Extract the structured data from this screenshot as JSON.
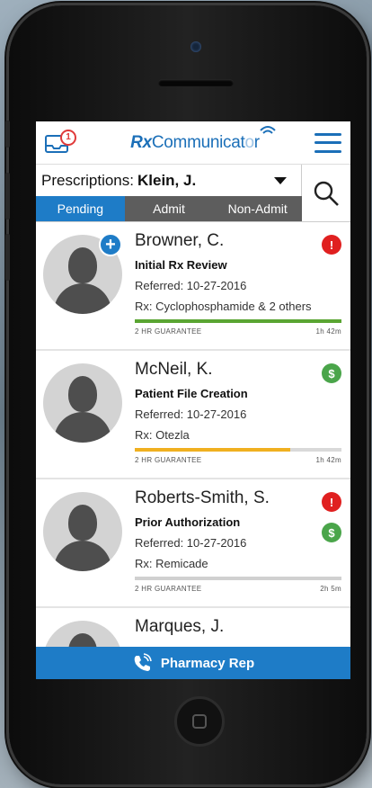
{
  "app": {
    "brand_prefix": "Rx",
    "brand_name": "Communicat",
    "brand_suffix": "r",
    "notifications": "1"
  },
  "filter": {
    "label": "Prescriptions:",
    "patient": "Klein, J.",
    "tabs": [
      {
        "label": "Pending",
        "active": true
      },
      {
        "label": "Admit",
        "active": false
      },
      {
        "label": "Non-Admit",
        "active": false
      }
    ]
  },
  "guarantee_label": "2 HR GUARANTEE",
  "items": [
    {
      "name": "Browner, C.",
      "task": "Initial Rx Review",
      "referred": "Referred: 10-27-2016",
      "rx": "Rx: Cyclophosphamide & 2 others",
      "timer": "1h 42m",
      "progress": 1.0,
      "bar_color": "#5aa532",
      "alert": true,
      "dollar": false,
      "add": true
    },
    {
      "name": "McNeil, K.",
      "task": "Patient File Creation",
      "referred": "Referred: 10-27-2016",
      "rx": "Rx: Otezla",
      "timer": "1h 42m",
      "progress": 0.75,
      "bar_color": "#f0b020",
      "alert": false,
      "dollar": true,
      "add": false
    },
    {
      "name": "Roberts-Smith, S.",
      "task": "Prior Authorization",
      "referred": "Referred: 10-27-2016",
      "rx": "Rx: Remicade",
      "timer": "2h 5m",
      "progress": 1.0,
      "bar_color": "#d0d0d0",
      "alert": true,
      "dollar": true,
      "add": false
    },
    {
      "name": "Marques, J."
    }
  ],
  "footer": {
    "label": "Pharmacy Rep"
  },
  "colors": {
    "accent": "#1e7cc7",
    "alert": "#e02020",
    "money": "#4aa54a"
  }
}
